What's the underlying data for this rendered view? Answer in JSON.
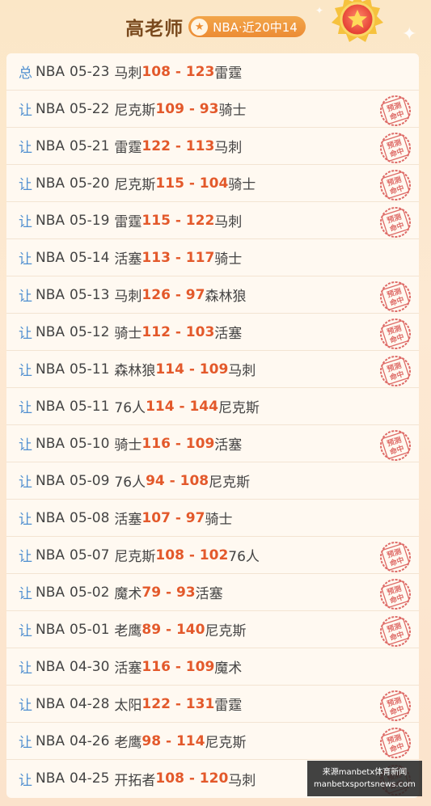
{
  "header": {
    "teacher_name": "高老师",
    "record": "NBA·近20中14"
  },
  "stamp_text": "预测命中",
  "rows": [
    {
      "tag": "总",
      "league": "NBA",
      "date": "05-23",
      "home": "马刺",
      "score": "108 - 123",
      "away": "雷霆",
      "hit": false
    },
    {
      "tag": "让",
      "league": "NBA",
      "date": "05-22",
      "home": "尼克斯",
      "score": "109 - 93",
      "away": "骑士",
      "hit": true
    },
    {
      "tag": "让",
      "league": "NBA",
      "date": "05-21",
      "home": "雷霆",
      "score": "122 - 113",
      "away": "马刺",
      "hit": true
    },
    {
      "tag": "让",
      "league": "NBA",
      "date": "05-20",
      "home": "尼克斯",
      "score": "115 - 104",
      "away": "骑士",
      "hit": true
    },
    {
      "tag": "让",
      "league": "NBA",
      "date": "05-19",
      "home": "雷霆",
      "score": "115 - 122",
      "away": "马刺",
      "hit": true
    },
    {
      "tag": "让",
      "league": "NBA",
      "date": "05-14",
      "home": "活塞",
      "score": "113 - 117",
      "away": "骑士",
      "hit": false
    },
    {
      "tag": "让",
      "league": "NBA",
      "date": "05-13",
      "home": "马刺",
      "score": "126 - 97",
      "away": "森林狼",
      "hit": true
    },
    {
      "tag": "让",
      "league": "NBA",
      "date": "05-12",
      "home": "骑士",
      "score": "112 - 103",
      "away": "活塞",
      "hit": true
    },
    {
      "tag": "让",
      "league": "NBA",
      "date": "05-11",
      "home": "森林狼",
      "score": "114 - 109",
      "away": "马刺",
      "hit": true
    },
    {
      "tag": "让",
      "league": "NBA",
      "date": "05-11",
      "home": "76人",
      "score": "114 - 144",
      "away": "尼克斯",
      "hit": false
    },
    {
      "tag": "让",
      "league": "NBA",
      "date": "05-10",
      "home": "骑士",
      "score": "116 - 109",
      "away": "活塞",
      "hit": true
    },
    {
      "tag": "让",
      "league": "NBA",
      "date": "05-09",
      "home": "76人",
      "score": "94 - 108",
      "away": "尼克斯",
      "hit": false
    },
    {
      "tag": "让",
      "league": "NBA",
      "date": "05-08",
      "home": "活塞",
      "score": "107 - 97",
      "away": "骑士",
      "hit": false
    },
    {
      "tag": "让",
      "league": "NBA",
      "date": "05-07",
      "home": "尼克斯",
      "score": "108 - 102",
      "away": "76人",
      "hit": true
    },
    {
      "tag": "让",
      "league": "NBA",
      "date": "05-02",
      "home": "魔术",
      "score": "79 - 93",
      "away": "活塞",
      "hit": true
    },
    {
      "tag": "让",
      "league": "NBA",
      "date": "05-01",
      "home": "老鹰",
      "score": "89 - 140",
      "away": "尼克斯",
      "hit": true
    },
    {
      "tag": "让",
      "league": "NBA",
      "date": "04-30",
      "home": "活塞",
      "score": "116 - 109",
      "away": "魔术",
      "hit": false
    },
    {
      "tag": "让",
      "league": "NBA",
      "date": "04-28",
      "home": "太阳",
      "score": "122 - 131",
      "away": "雷霆",
      "hit": true
    },
    {
      "tag": "让",
      "league": "NBA",
      "date": "04-26",
      "home": "老鹰",
      "score": "98 - 114",
      "away": "尼克斯",
      "hit": true
    },
    {
      "tag": "让",
      "league": "NBA",
      "date": "04-25",
      "home": "开拓者",
      "score": "108 - 120",
      "away": "马刺",
      "hit": true
    }
  ],
  "watermark": {
    "line1": "来源manbetx体育新闻",
    "line2": "manbetxsportsnews.com"
  },
  "colors": {
    "tag": "#4f8fd0",
    "score": "#e3592b",
    "stamp": "#d9534f"
  }
}
